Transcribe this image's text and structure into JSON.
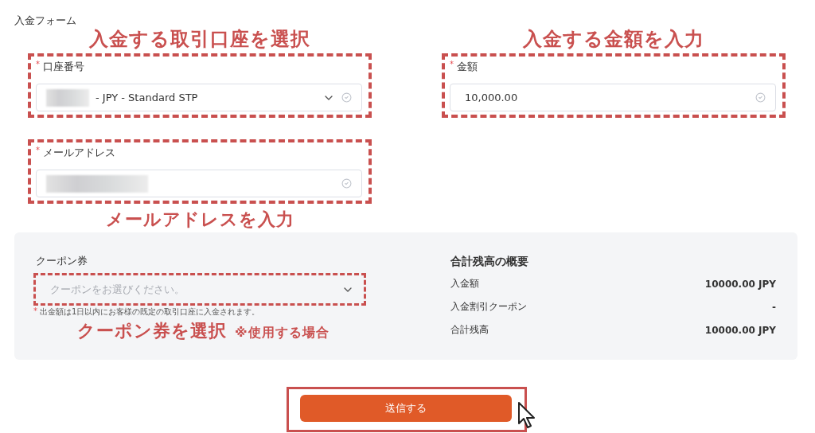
{
  "form_title": "入金フォーム",
  "account": {
    "annotation": "入金する取引口座を選択",
    "mark": "*",
    "label": "口座番号",
    "masked": true,
    "value": "- JPY - Standard STP"
  },
  "amount": {
    "annotation": "入金する金額を入力",
    "mark": "*",
    "label": "金額",
    "value": "10,000.00"
  },
  "email": {
    "mark": "*",
    "label": "メールアドレス",
    "masked": true,
    "annotation": "メールアドレスを入力"
  },
  "coupon": {
    "label": "クーポン券",
    "placeholder": "クーポンをお選びください。",
    "note_mark": "*",
    "note": "出金額は1日以内にお客様の既定の取引口座に入金されます。",
    "annotation": "クーポン券を選択",
    "annotation_note": "※使用する場合"
  },
  "summary": {
    "title": "合計残高の概要",
    "rows": [
      {
        "label": "入金額",
        "value": "10000.00 JPY"
      },
      {
        "label": "入金割引クーポン",
        "value": "-"
      },
      {
        "label": "合計残高",
        "value": "10000.00 JPY"
      }
    ]
  },
  "submit": {
    "label": "送信する"
  }
}
